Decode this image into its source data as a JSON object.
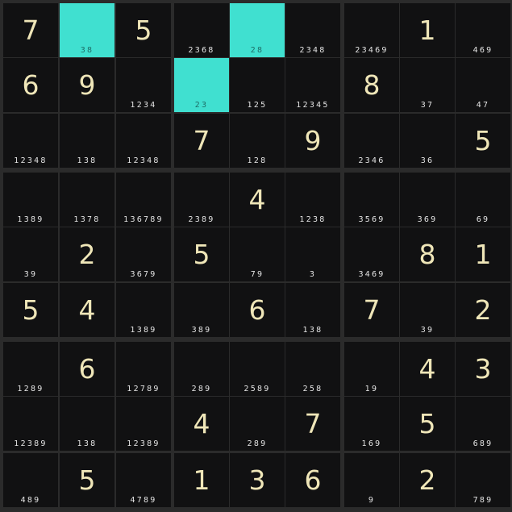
{
  "colors": {
    "background": "#111112",
    "grid": "#2b2b2b",
    "highlight": "#40e0d0",
    "digit": "#efe6b8",
    "notes": "#e6e6e6"
  },
  "grid": [
    [
      {
        "v": "7",
        "n": ""
      },
      {
        "v": "",
        "n": "38",
        "h": true
      },
      {
        "v": "5",
        "n": ""
      },
      {
        "v": "",
        "n": "2368"
      },
      {
        "v": "",
        "n": "28",
        "h": true
      },
      {
        "v": "",
        "n": "2348"
      },
      {
        "v": "",
        "n": "23469"
      },
      {
        "v": "1",
        "n": ""
      },
      {
        "v": "",
        "n": "469"
      }
    ],
    [
      {
        "v": "6",
        "n": ""
      },
      {
        "v": "9",
        "n": ""
      },
      {
        "v": "",
        "n": "1234"
      },
      {
        "v": "",
        "n": "23",
        "h": true
      },
      {
        "v": "",
        "n": "125"
      },
      {
        "v": "",
        "n": "12345"
      },
      {
        "v": "8",
        "n": ""
      },
      {
        "v": "",
        "n": "37"
      },
      {
        "v": "",
        "n": "47"
      }
    ],
    [
      {
        "v": "",
        "n": "12348"
      },
      {
        "v": "",
        "n": "138"
      },
      {
        "v": "",
        "n": "12348"
      },
      {
        "v": "7",
        "n": ""
      },
      {
        "v": "",
        "n": "128"
      },
      {
        "v": "9",
        "n": ""
      },
      {
        "v": "",
        "n": "2346"
      },
      {
        "v": "",
        "n": "36"
      },
      {
        "v": "5",
        "n": ""
      }
    ],
    [
      {
        "v": "",
        "n": "1389"
      },
      {
        "v": "",
        "n": "1378"
      },
      {
        "v": "",
        "n": "136789"
      },
      {
        "v": "",
        "n": "2389"
      },
      {
        "v": "4",
        "n": ""
      },
      {
        "v": "",
        "n": "1238"
      },
      {
        "v": "",
        "n": "3569"
      },
      {
        "v": "",
        "n": "369"
      },
      {
        "v": "",
        "n": "69"
      }
    ],
    [
      {
        "v": "",
        "n": "39"
      },
      {
        "v": "2",
        "n": ""
      },
      {
        "v": "",
        "n": "3679"
      },
      {
        "v": "5",
        "n": ""
      },
      {
        "v": "",
        "n": "79"
      },
      {
        "v": "",
        "n": "3"
      },
      {
        "v": "",
        "n": "3469"
      },
      {
        "v": "8",
        "n": ""
      },
      {
        "v": "1",
        "n": ""
      }
    ],
    [
      {
        "v": "5",
        "n": ""
      },
      {
        "v": "4",
        "n": ""
      },
      {
        "v": "",
        "n": "1389"
      },
      {
        "v": "",
        "n": "389"
      },
      {
        "v": "6",
        "n": ""
      },
      {
        "v": "",
        "n": "138"
      },
      {
        "v": "7",
        "n": ""
      },
      {
        "v": "",
        "n": "39"
      },
      {
        "v": "2",
        "n": ""
      }
    ],
    [
      {
        "v": "",
        "n": "1289"
      },
      {
        "v": "6",
        "n": ""
      },
      {
        "v": "",
        "n": "12789"
      },
      {
        "v": "",
        "n": "289"
      },
      {
        "v": "",
        "n": "2589"
      },
      {
        "v": "",
        "n": "258"
      },
      {
        "v": "",
        "n": "19"
      },
      {
        "v": "4",
        "n": ""
      },
      {
        "v": "3",
        "n": ""
      }
    ],
    [
      {
        "v": "",
        "n": "12389"
      },
      {
        "v": "",
        "n": "138"
      },
      {
        "v": "",
        "n": "12389"
      },
      {
        "v": "4",
        "n": ""
      },
      {
        "v": "",
        "n": "289"
      },
      {
        "v": "7",
        "n": ""
      },
      {
        "v": "",
        "n": "169"
      },
      {
        "v": "5",
        "n": ""
      },
      {
        "v": "",
        "n": "689"
      }
    ],
    [
      {
        "v": "",
        "n": "489"
      },
      {
        "v": "5",
        "n": ""
      },
      {
        "v": "",
        "n": "4789"
      },
      {
        "v": "1",
        "n": ""
      },
      {
        "v": "3",
        "n": ""
      },
      {
        "v": "6",
        "n": ""
      },
      {
        "v": "",
        "n": "9"
      },
      {
        "v": "2",
        "n": ""
      },
      {
        "v": "",
        "n": "789"
      }
    ]
  ]
}
